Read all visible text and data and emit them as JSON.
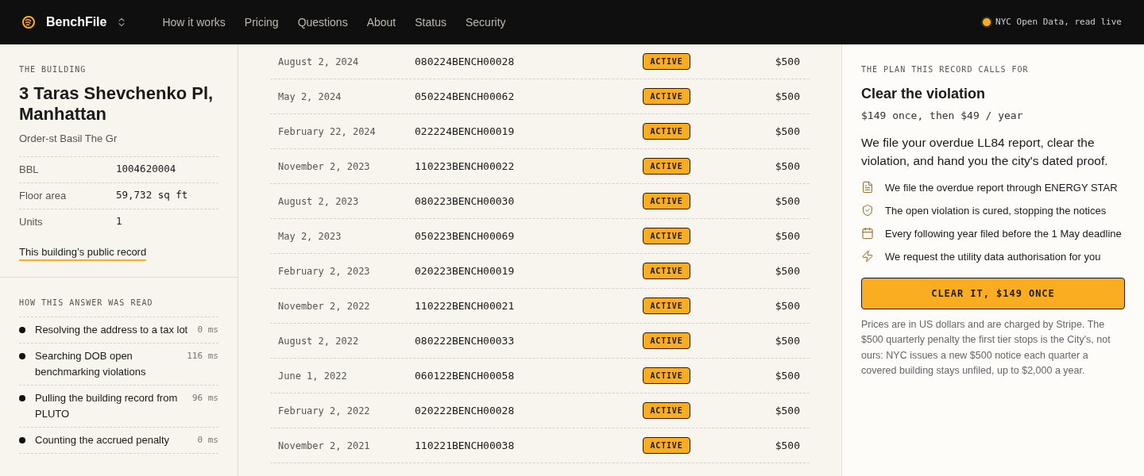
{
  "brand": {
    "name": "BenchFile"
  },
  "nav": [
    "How it works",
    "Pricing",
    "Questions",
    "About",
    "Status",
    "Security"
  ],
  "live_status": {
    "label": "NYC Open Data, read live"
  },
  "building": {
    "eyebrow": "THE BUILDING",
    "address": "3 Taras Shevchenko Pl, Manhattan",
    "owner": "Order-st Basil The Gr",
    "facts": [
      {
        "label": "BBL",
        "value": "1004620004"
      },
      {
        "label": "Floor area",
        "value": "59,732 sq ft"
      },
      {
        "label": "Units",
        "value": "1"
      }
    ],
    "link": "This building’s public record"
  },
  "trace": {
    "eyebrow": "HOW THIS ANSWER WAS READ",
    "steps": [
      {
        "text": "Resolving the address to a tax lot",
        "time": "0 ms"
      },
      {
        "text": "Searching DOB open benchmarking violations",
        "time": "116 ms"
      },
      {
        "text": "Pulling the building record from PLUTO",
        "time": "96 ms"
      },
      {
        "text": "Counting the accrued penalty",
        "time": "0 ms"
      }
    ]
  },
  "violations": [
    {
      "date": "August 2, 2024",
      "id": "080224BENCH00028",
      "status": "ACTIVE",
      "kind": "active",
      "amount": "$500"
    },
    {
      "date": "May 2, 2024",
      "id": "050224BENCH00062",
      "status": "ACTIVE",
      "kind": "active",
      "amount": "$500"
    },
    {
      "date": "February 22, 2024",
      "id": "022224BENCH00019",
      "status": "ACTIVE",
      "kind": "active",
      "amount": "$500"
    },
    {
      "date": "November 2, 2023",
      "id": "110223BENCH00022",
      "status": "ACTIVE",
      "kind": "active",
      "amount": "$500"
    },
    {
      "date": "August 2, 2023",
      "id": "080223BENCH00030",
      "status": "ACTIVE",
      "kind": "active",
      "amount": "$500"
    },
    {
      "date": "May 2, 2023",
      "id": "050223BENCH00069",
      "status": "ACTIVE",
      "kind": "active",
      "amount": "$500"
    },
    {
      "date": "February 2, 2023",
      "id": "020223BENCH00019",
      "status": "ACTIVE",
      "kind": "active",
      "amount": "$500"
    },
    {
      "date": "November 2, 2022",
      "id": "110222BENCH00021",
      "status": "ACTIVE",
      "kind": "active",
      "amount": "$500"
    },
    {
      "date": "August 2, 2022",
      "id": "080222BENCH00033",
      "status": "ACTIVE",
      "kind": "active",
      "amount": "$500"
    },
    {
      "date": "June 1, 2022",
      "id": "060122BENCH00058",
      "status": "ACTIVE",
      "kind": "active",
      "amount": "$500"
    },
    {
      "date": "February 2, 2022",
      "id": "020222BENCH00028",
      "status": "ACTIVE",
      "kind": "active",
      "amount": "$500"
    },
    {
      "date": "November 2, 2021",
      "id": "110221BENCH00038",
      "status": "ACTIVE",
      "kind": "active",
      "amount": "$500"
    }
  ],
  "plan": {
    "eyebrow": "THE PLAN THIS RECORD CALLS FOR",
    "title": "Clear the violation",
    "price": "$149 once, then $49 / year",
    "summary": "We file your overdue LL84 report, clear the violation, and hand you the city's dated proof.",
    "features": [
      {
        "kind": "document",
        "text": "We file the overdue report through ENERGY STAR"
      },
      {
        "kind": "shield",
        "text": "The open violation is cured, stopping the notices"
      },
      {
        "kind": "calendar",
        "text": "Every following year filed before the 1 May deadline"
      },
      {
        "kind": "bolt",
        "text": "We request the utility data authorisation for you"
      }
    ],
    "cta": "CLEAR IT, $149 ONCE",
    "note": "Prices are in US dollars and are charged by Stripe. The $500 quarterly penalty the first tier stops is the City's, not ours: NYC issues a new $500 notice each quarter a covered building stays unfiled, up to $2,000 a year."
  }
}
